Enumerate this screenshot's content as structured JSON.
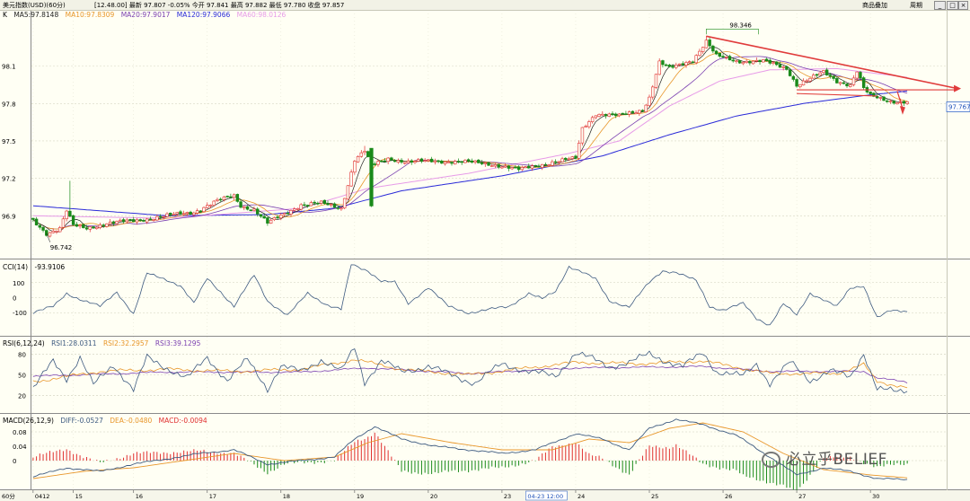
{
  "header": {
    "instrument": "美元指数(USD)(60分)",
    "quote": "[12.48.00] 最新 97.807 -0.05% 今开 97.841 最高 97.882 最低 97.780 收盘 97.857",
    "menu_add": "商品叠加",
    "menu_cycle": "周期"
  },
  "colors": {
    "ma5": "#222222",
    "ma10": "#e8962a",
    "ma20": "#7a3fb0",
    "ma120": "#2a2ad8",
    "ma60": "#e79be8",
    "up": "#e03030",
    "down": "#1a8a1a",
    "trend": "#e03b3b",
    "lag_line": "#3d5a80",
    "cci": "#3d5a80",
    "rsi1": "#3d5a80",
    "rsi2": "#e8962a",
    "rsi3": "#7a3fb0",
    "dea": "#e8962a",
    "diff": "#3d5a80"
  },
  "legends": {
    "price": {
      "title": "K",
      "ma5": "MA5:97.8148",
      "ma10": "MA10:97.8309",
      "ma20": "MA20:97.9017",
      "ma120": "MA120:97.9066",
      "ma60": "MA60:98.0126"
    },
    "cci": {
      "title": "CCI(14)",
      "value": "-93.9106"
    },
    "rsi": {
      "title": "RSI(6,12,24)",
      "rsi1": "RSI1:28.0311",
      "rsi2": "RSI2:32.2957",
      "rsi3": "RSI3:39.1295"
    },
    "macd": {
      "title": "MACD(26,12,9)",
      "diff": "DIFF:-0.0527",
      "dea": "DEA:-0.0480",
      "macd": "MACD:-0.0094"
    }
  },
  "chart_data": [
    {
      "type": "candlestick",
      "period": "60分",
      "ylim": [
        96.6,
        98.45
      ],
      "y_ticks": [
        96.9,
        97.2,
        97.5,
        97.8,
        98.1
      ],
      "y_tick_labels": [
        "96.9",
        "97.2",
        "97.5",
        "97.8",
        "98.1"
      ],
      "x_ticks": [
        {
          "label": "0412",
          "idx": 0
        },
        {
          "label": "15",
          "idx": 12
        },
        {
          "label": "16",
          "idx": 30
        },
        {
          "label": "17",
          "idx": 52
        },
        {
          "label": "18",
          "idx": 74
        },
        {
          "label": "19",
          "idx": 96
        },
        {
          "label": "20",
          "idx": 118
        },
        {
          "label": "23",
          "idx": 140
        },
        {
          "label": "24",
          "idx": 162
        },
        {
          "label": "25",
          "idx": 184
        },
        {
          "label": "26",
          "idx": 206
        },
        {
          "label": "27",
          "idx": 228
        },
        {
          "label": "30",
          "idx": 250
        }
      ],
      "cursor_label": "04-23 12:00",
      "cursor_idx": 153,
      "bar_count": 262,
      "anchors": [
        [
          0,
          96.86
        ],
        [
          4,
          96.76
        ],
        [
          8,
          96.8
        ],
        [
          10,
          96.94
        ],
        [
          12,
          96.82
        ],
        [
          16,
          96.8
        ],
        [
          22,
          96.84
        ],
        [
          30,
          96.86
        ],
        [
          40,
          96.9
        ],
        [
          48,
          96.93
        ],
        [
          55,
          97.02
        ],
        [
          60,
          97.06
        ],
        [
          62,
          96.98
        ],
        [
          66,
          96.95
        ],
        [
          70,
          96.84
        ],
        [
          74,
          96.9
        ],
        [
          80,
          96.99
        ],
        [
          86,
          97.0
        ],
        [
          92,
          96.96
        ],
        [
          94,
          97.15
        ],
        [
          96,
          97.35
        ],
        [
          99,
          97.42
        ],
        [
          101,
          97.3
        ],
        [
          106,
          97.36
        ],
        [
          112,
          97.33
        ],
        [
          120,
          97.34
        ],
        [
          130,
          97.33
        ],
        [
          138,
          97.31
        ],
        [
          145,
          97.27
        ],
        [
          155,
          97.33
        ],
        [
          162,
          97.36
        ],
        [
          164,
          97.6
        ],
        [
          168,
          97.72
        ],
        [
          175,
          97.7
        ],
        [
          182,
          97.75
        ],
        [
          184,
          97.85
        ],
        [
          187,
          98.13
        ],
        [
          190,
          98.08
        ],
        [
          197,
          98.15
        ],
        [
          201,
          98.3
        ],
        [
          204,
          98.18
        ],
        [
          210,
          98.14
        ],
        [
          218,
          98.14
        ],
        [
          225,
          98.08
        ],
        [
          228,
          97.95
        ],
        [
          232,
          98.0
        ],
        [
          236,
          98.05
        ],
        [
          240,
          97.98
        ],
        [
          244,
          97.95
        ],
        [
          246,
          98.06
        ],
        [
          248,
          97.92
        ],
        [
          250,
          97.86
        ],
        [
          256,
          97.82
        ],
        [
          261,
          97.81
        ]
      ],
      "tail_wicks": [
        {
          "idx": 11,
          "hi": 97.18
        },
        {
          "idx": 201,
          "hi": 98.34
        },
        {
          "idx": 99,
          "hi": 97.46
        },
        {
          "idx": 101,
          "lo": 96.97
        }
      ],
      "ma120_pts": [
        [
          0,
          96.98
        ],
        [
          40,
          96.9
        ],
        [
          70,
          96.91
        ],
        [
          90,
          96.96
        ],
        [
          110,
          97.1
        ],
        [
          140,
          97.22
        ],
        [
          170,
          97.38
        ],
        [
          190,
          97.55
        ],
        [
          210,
          97.7
        ],
        [
          230,
          97.8
        ],
        [
          250,
          97.87
        ],
        [
          261,
          97.9
        ]
      ],
      "ma60_pts": [
        [
          0,
          96.9
        ],
        [
          40,
          96.88
        ],
        [
          80,
          96.96
        ],
        [
          100,
          97.12
        ],
        [
          130,
          97.24
        ],
        [
          160,
          97.4
        ],
        [
          175,
          97.5
        ],
        [
          190,
          97.78
        ],
        [
          205,
          97.98
        ],
        [
          220,
          98.07
        ],
        [
          240,
          98.08
        ],
        [
          261,
          98.01
        ]
      ],
      "high_label": "98.346",
      "high_idx": 201,
      "low_label": "96.742",
      "low_idx": 4,
      "last_price_label": "97.767",
      "trend_lines": [
        {
          "from": [
            201,
            98.34
          ],
          "to": [
            276,
            97.92
          ]
        },
        {
          "from": [
            228,
            97.91
          ],
          "to": [
            276,
            97.91
          ]
        },
        {
          "from": [
            228,
            97.88
          ],
          "to": [
            252,
            97.86
          ]
        }
      ]
    },
    {
      "type": "line",
      "name": "CCI(14)",
      "ylim": [
        -230,
        230
      ],
      "y_ticks": [
        100,
        0,
        -100
      ],
      "y_tick_labels": [
        "100",
        "0",
        "-100"
      ],
      "anchors": [
        [
          0,
          -100
        ],
        [
          6,
          -60
        ],
        [
          10,
          30
        ],
        [
          15,
          -20
        ],
        [
          20,
          -60
        ],
        [
          25,
          40
        ],
        [
          30,
          -110
        ],
        [
          34,
          160
        ],
        [
          40,
          120
        ],
        [
          44,
          80
        ],
        [
          48,
          -40
        ],
        [
          52,
          130
        ],
        [
          56,
          40
        ],
        [
          60,
          -60
        ],
        [
          66,
          150
        ],
        [
          70,
          -20
        ],
        [
          76,
          -120
        ],
        [
          82,
          30
        ],
        [
          88,
          -50
        ],
        [
          92,
          -80
        ],
        [
          95,
          220
        ],
        [
          100,
          180
        ],
        [
          104,
          110
        ],
        [
          108,
          100
        ],
        [
          112,
          -40
        ],
        [
          118,
          70
        ],
        [
          124,
          -60
        ],
        [
          130,
          -100
        ],
        [
          136,
          -80
        ],
        [
          142,
          -60
        ],
        [
          148,
          30
        ],
        [
          152,
          -10
        ],
        [
          156,
          40
        ],
        [
          160,
          210
        ],
        [
          164,
          170
        ],
        [
          168,
          120
        ],
        [
          172,
          -20
        ],
        [
          178,
          -60
        ],
        [
          184,
          100
        ],
        [
          188,
          180
        ],
        [
          192,
          170
        ],
        [
          198,
          110
        ],
        [
          202,
          -60
        ],
        [
          206,
          -80
        ],
        [
          212,
          -40
        ],
        [
          216,
          -140
        ],
        [
          220,
          -180
        ],
        [
          224,
          -40
        ],
        [
          228,
          -120
        ],
        [
          232,
          30
        ],
        [
          236,
          -10
        ],
        [
          240,
          -60
        ],
        [
          244,
          60
        ],
        [
          248,
          80
        ],
        [
          252,
          -130
        ],
        [
          256,
          -90
        ],
        [
          261,
          -94
        ]
      ]
    },
    {
      "type": "line",
      "name": "RSI(6,12,24)",
      "ylim": [
        0,
        100
      ],
      "y_ticks": [
        80,
        50,
        20
      ],
      "y_tick_labels": [
        "80",
        "50",
        "20"
      ],
      "series": [
        {
          "name": "RSI1:28.0311",
          "anchors": [
            [
              0,
              30
            ],
            [
              6,
              70
            ],
            [
              10,
              45
            ],
            [
              14,
              75
            ],
            [
              18,
              35
            ],
            [
              24,
              65
            ],
            [
              30,
              28
            ],
            [
              34,
              75
            ],
            [
              40,
              60
            ],
            [
              46,
              45
            ],
            [
              52,
              75
            ],
            [
              58,
              42
            ],
            [
              64,
              72
            ],
            [
              70,
              30
            ],
            [
              74,
              62
            ],
            [
              80,
              55
            ],
            [
              86,
              72
            ],
            [
              92,
              55
            ],
            [
              96,
              90
            ],
            [
              99,
              40
            ],
            [
              104,
              70
            ],
            [
              110,
              55
            ],
            [
              118,
              62
            ],
            [
              126,
              48
            ],
            [
              132,
              38
            ],
            [
              140,
              66
            ],
            [
              148,
              55
            ],
            [
              156,
              48
            ],
            [
              162,
              82
            ],
            [
              166,
              75
            ],
            [
              172,
              62
            ],
            [
              178,
              68
            ],
            [
              184,
              80
            ],
            [
              188,
              72
            ],
            [
              194,
              62
            ],
            [
              200,
              82
            ],
            [
              204,
              55
            ],
            [
              212,
              48
            ],
            [
              216,
              66
            ],
            [
              220,
              38
            ],
            [
              226,
              68
            ],
            [
              232,
              42
            ],
            [
              238,
              56
            ],
            [
              244,
              46
            ],
            [
              248,
              82
            ],
            [
              252,
              30
            ],
            [
              258,
              25
            ],
            [
              261,
              28
            ]
          ]
        },
        {
          "name": "RSI2:32.2957",
          "anchors": [
            [
              0,
              40
            ],
            [
              20,
              55
            ],
            [
              40,
              58
            ],
            [
              60,
              55
            ],
            [
              80,
              58
            ],
            [
              96,
              72
            ],
            [
              110,
              58
            ],
            [
              130,
              50
            ],
            [
              162,
              68
            ],
            [
              180,
              66
            ],
            [
              200,
              70
            ],
            [
              220,
              52
            ],
            [
              240,
              52
            ],
            [
              248,
              65
            ],
            [
              252,
              40
            ],
            [
              261,
              32
            ]
          ]
        },
        {
          "name": "RSI3:39.1295",
          "anchors": [
            [
              0,
              48
            ],
            [
              40,
              54
            ],
            [
              80,
              54
            ],
            [
              100,
              60
            ],
            [
              130,
              52
            ],
            [
              162,
              60
            ],
            [
              200,
              62
            ],
            [
              220,
              55
            ],
            [
              248,
              55
            ],
            [
              252,
              46
            ],
            [
              261,
              39
            ]
          ]
        }
      ]
    },
    {
      "type": "bar_line",
      "name": "MACD(26,12,9)",
      "ylim": [
        -0.07,
        0.12
      ],
      "y_ticks": [
        0.08,
        0.04,
        0
      ],
      "y_tick_labels": [
        "0.08",
        "0.04",
        "0"
      ],
      "diff_anchors": [
        [
          0,
          -0.045
        ],
        [
          10,
          -0.02
        ],
        [
          20,
          -0.03
        ],
        [
          30,
          -0.01
        ],
        [
          40,
          0.005
        ],
        [
          50,
          0.02
        ],
        [
          60,
          0.03
        ],
        [
          70,
          -0.01
        ],
        [
          80,
          0.0
        ],
        [
          90,
          0.01
        ],
        [
          96,
          0.06
        ],
        [
          102,
          0.095
        ],
        [
          110,
          0.06
        ],
        [
          120,
          0.04
        ],
        [
          130,
          0.03
        ],
        [
          140,
          0.02
        ],
        [
          150,
          0.03
        ],
        [
          162,
          0.075
        ],
        [
          170,
          0.06
        ],
        [
          178,
          0.03
        ],
        [
          184,
          0.09
        ],
        [
          192,
          0.115
        ],
        [
          200,
          0.1
        ],
        [
          210,
          0.07
        ],
        [
          220,
          0.01
        ],
        [
          228,
          -0.04
        ],
        [
          236,
          -0.02
        ],
        [
          244,
          -0.03
        ],
        [
          252,
          -0.05
        ],
        [
          261,
          -0.053
        ]
      ],
      "dea_anchors": [
        [
          0,
          -0.05
        ],
        [
          15,
          -0.03
        ],
        [
          30,
          -0.02
        ],
        [
          45,
          0.0
        ],
        [
          60,
          0.02
        ],
        [
          75,
          0.0
        ],
        [
          90,
          0.01
        ],
        [
          100,
          0.05
        ],
        [
          110,
          0.075
        ],
        [
          125,
          0.05
        ],
        [
          140,
          0.03
        ],
        [
          155,
          0.03
        ],
        [
          166,
          0.06
        ],
        [
          178,
          0.05
        ],
        [
          190,
          0.09
        ],
        [
          200,
          0.105
        ],
        [
          212,
          0.08
        ],
        [
          224,
          0.02
        ],
        [
          236,
          -0.025
        ],
        [
          250,
          -0.04
        ],
        [
          261,
          -0.048
        ]
      ]
    }
  ]
}
